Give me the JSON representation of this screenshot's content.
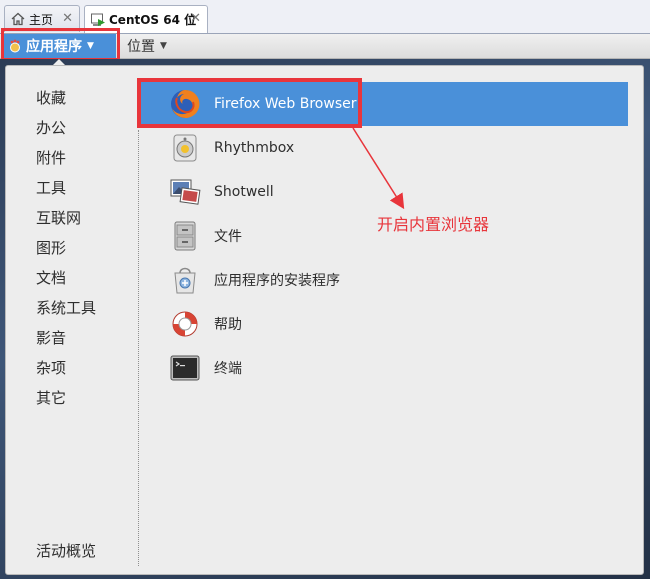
{
  "tabs": [
    {
      "label": "主页",
      "icon": "home-icon"
    },
    {
      "label": "CentOS 64 位",
      "icon": "vm-icon"
    }
  ],
  "topbar": {
    "applications_label": "应用程序",
    "places_label": "位置"
  },
  "categories": [
    "收藏",
    "办公",
    "附件",
    "工具",
    "互联网",
    "图形",
    "文档",
    "系统工具",
    "影音",
    "杂项",
    "其它"
  ],
  "activities_label": "活动概览",
  "apps": [
    {
      "label": "Firefox Web Browser",
      "icon": "firefox-icon",
      "selected": true
    },
    {
      "label": "Rhythmbox",
      "icon": "rhythmbox-icon"
    },
    {
      "label": "Shotwell",
      "icon": "shotwell-icon"
    },
    {
      "label": "文件",
      "icon": "files-icon"
    },
    {
      "label": "应用程序的安装程序",
      "icon": "software-installer-icon"
    },
    {
      "label": "帮助",
      "icon": "help-icon"
    },
    {
      "label": "终端",
      "icon": "terminal-icon"
    }
  ],
  "annotation": "开启内置浏览器",
  "colors": {
    "highlight_box": "#e8353b",
    "selected_row": "#4a90d9",
    "menu_bg": "#ededed"
  }
}
